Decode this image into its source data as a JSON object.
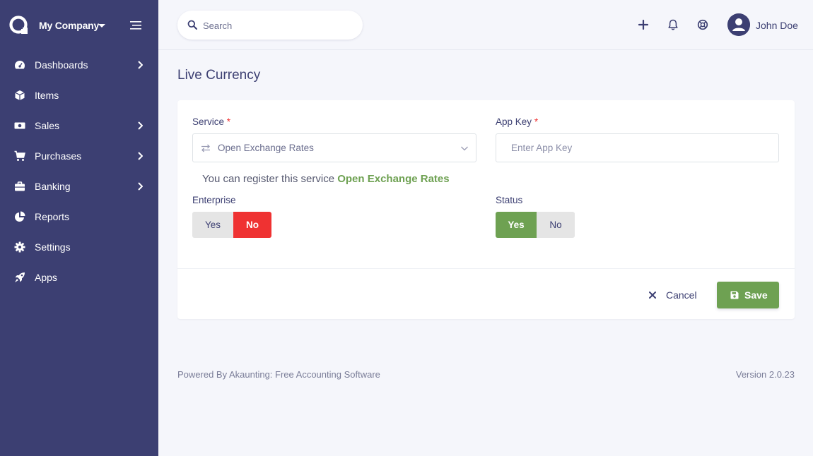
{
  "company": {
    "name": "My Company"
  },
  "sidebar": {
    "items": [
      {
        "label": "Dashboards",
        "icon": "dashboard-gauge-icon",
        "has_submenu": true
      },
      {
        "label": "Items",
        "icon": "cube-icon",
        "has_submenu": false
      },
      {
        "label": "Sales",
        "icon": "money-bill-icon",
        "has_submenu": true
      },
      {
        "label": "Purchases",
        "icon": "shopping-cart-icon",
        "has_submenu": true
      },
      {
        "label": "Banking",
        "icon": "briefcase-icon",
        "has_submenu": true
      },
      {
        "label": "Reports",
        "icon": "chart-pie-icon",
        "has_submenu": false
      },
      {
        "label": "Settings",
        "icon": "gear-icon",
        "has_submenu": false
      },
      {
        "label": "Apps",
        "icon": "rocket-icon",
        "has_submenu": false
      }
    ]
  },
  "header": {
    "search_placeholder": "Search",
    "user_name": "John Doe"
  },
  "page": {
    "title": "Live Currency"
  },
  "form": {
    "service_label": "Service",
    "service_value": "Open Exchange Rates",
    "app_key_label": "App Key",
    "app_key_placeholder": "Enter App Key",
    "required_mark": "*",
    "hint_text": "You can register this service ",
    "hint_link": "Open Exchange Rates",
    "enterprise_label": "Enterprise",
    "enterprise_yes": "Yes",
    "enterprise_no": "No",
    "enterprise_selected": "No",
    "status_label": "Status",
    "status_yes": "Yes",
    "status_no": "No",
    "status_selected": "Yes",
    "cancel_label": "Cancel",
    "save_label": "Save"
  },
  "footer": {
    "powered_by": "Powered By Akaunting: Free Accounting Software",
    "version": "Version 2.0.23"
  },
  "colors": {
    "sidebar_bg": "#3c3f72",
    "accent_green": "#6ea152",
    "danger_red": "#ef3232",
    "page_bg": "#f5f6fb"
  }
}
